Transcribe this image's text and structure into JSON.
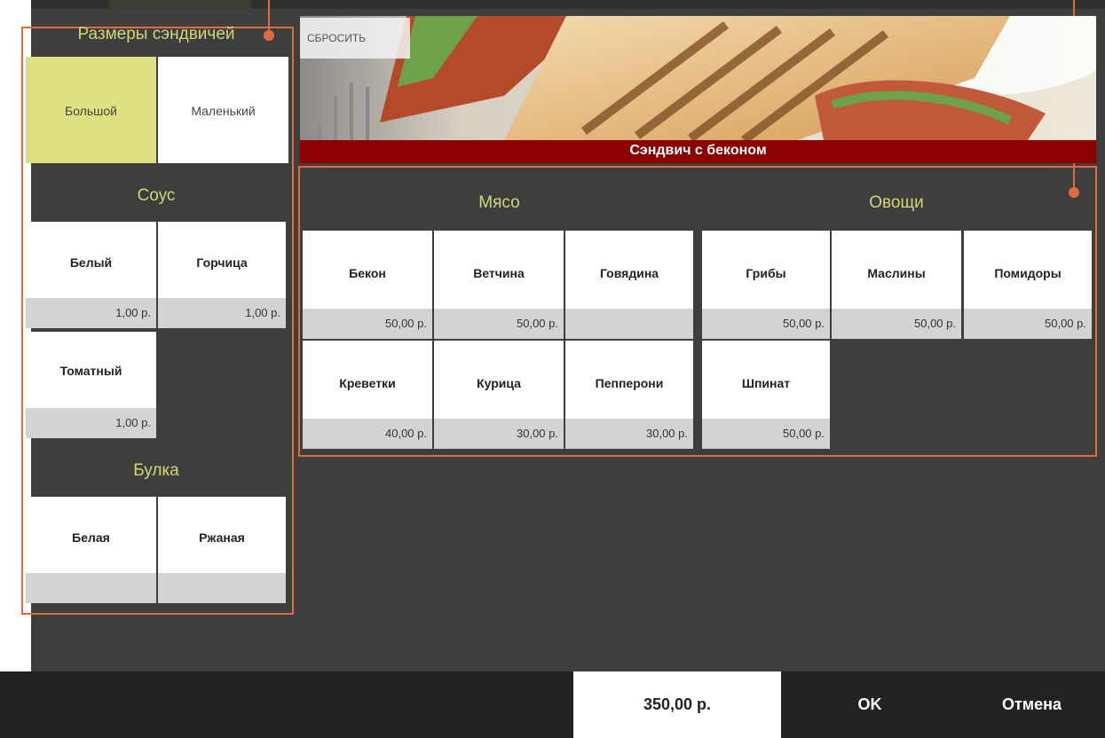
{
  "left_panel": {
    "sizes_title": "Размеры сэндвичей",
    "sizes": [
      "Большой",
      "Маленький"
    ],
    "selected_size": "Большой",
    "sauce_title": "Соус",
    "sauces": [
      {
        "name": "Белый",
        "price": "1,00 р."
      },
      {
        "name": "Горчица",
        "price": "1,00 р."
      },
      {
        "name": "Томатный",
        "price": "1,00 р."
      }
    ],
    "bun_title": "Булка",
    "buns": [
      {
        "name": "Белая",
        "price": ""
      },
      {
        "name": "Ржаная",
        "price": ""
      }
    ]
  },
  "banner": {
    "reset_label": "СБРОСИТЬ",
    "product_title": "Сэндвич с беконом"
  },
  "toppings": {
    "meat_title": "Мясо",
    "veg_title": "Овощи",
    "meat": [
      {
        "name": "Бекон",
        "price": "50,00 р."
      },
      {
        "name": "Ветчина",
        "price": "50,00 р."
      },
      {
        "name": "Говядина",
        "price": ""
      },
      {
        "name": "Креветки",
        "price": "40,00 р."
      },
      {
        "name": "Курица",
        "price": "30,00 р."
      },
      {
        "name": "Пепперони",
        "price": "30,00 р."
      }
    ],
    "veg": [
      {
        "name": "Грибы",
        "price": "50,00 р."
      },
      {
        "name": "Маслины",
        "price": "50,00 р."
      },
      {
        "name": "Помидоры",
        "price": "50,00 р."
      },
      {
        "name": "Шпинат",
        "price": "50,00 р."
      }
    ]
  },
  "footer": {
    "total": "350,00 р.",
    "ok_label": "OK",
    "cancel_label": "Отмена"
  },
  "colors": {
    "panel_bg": "#3d3f3d",
    "accent_title": "#d6d47a",
    "selected_tile": "#dfe07f",
    "callout": "#e06a43",
    "title_bar": "#8b0000",
    "footer_bg": "#232323"
  }
}
